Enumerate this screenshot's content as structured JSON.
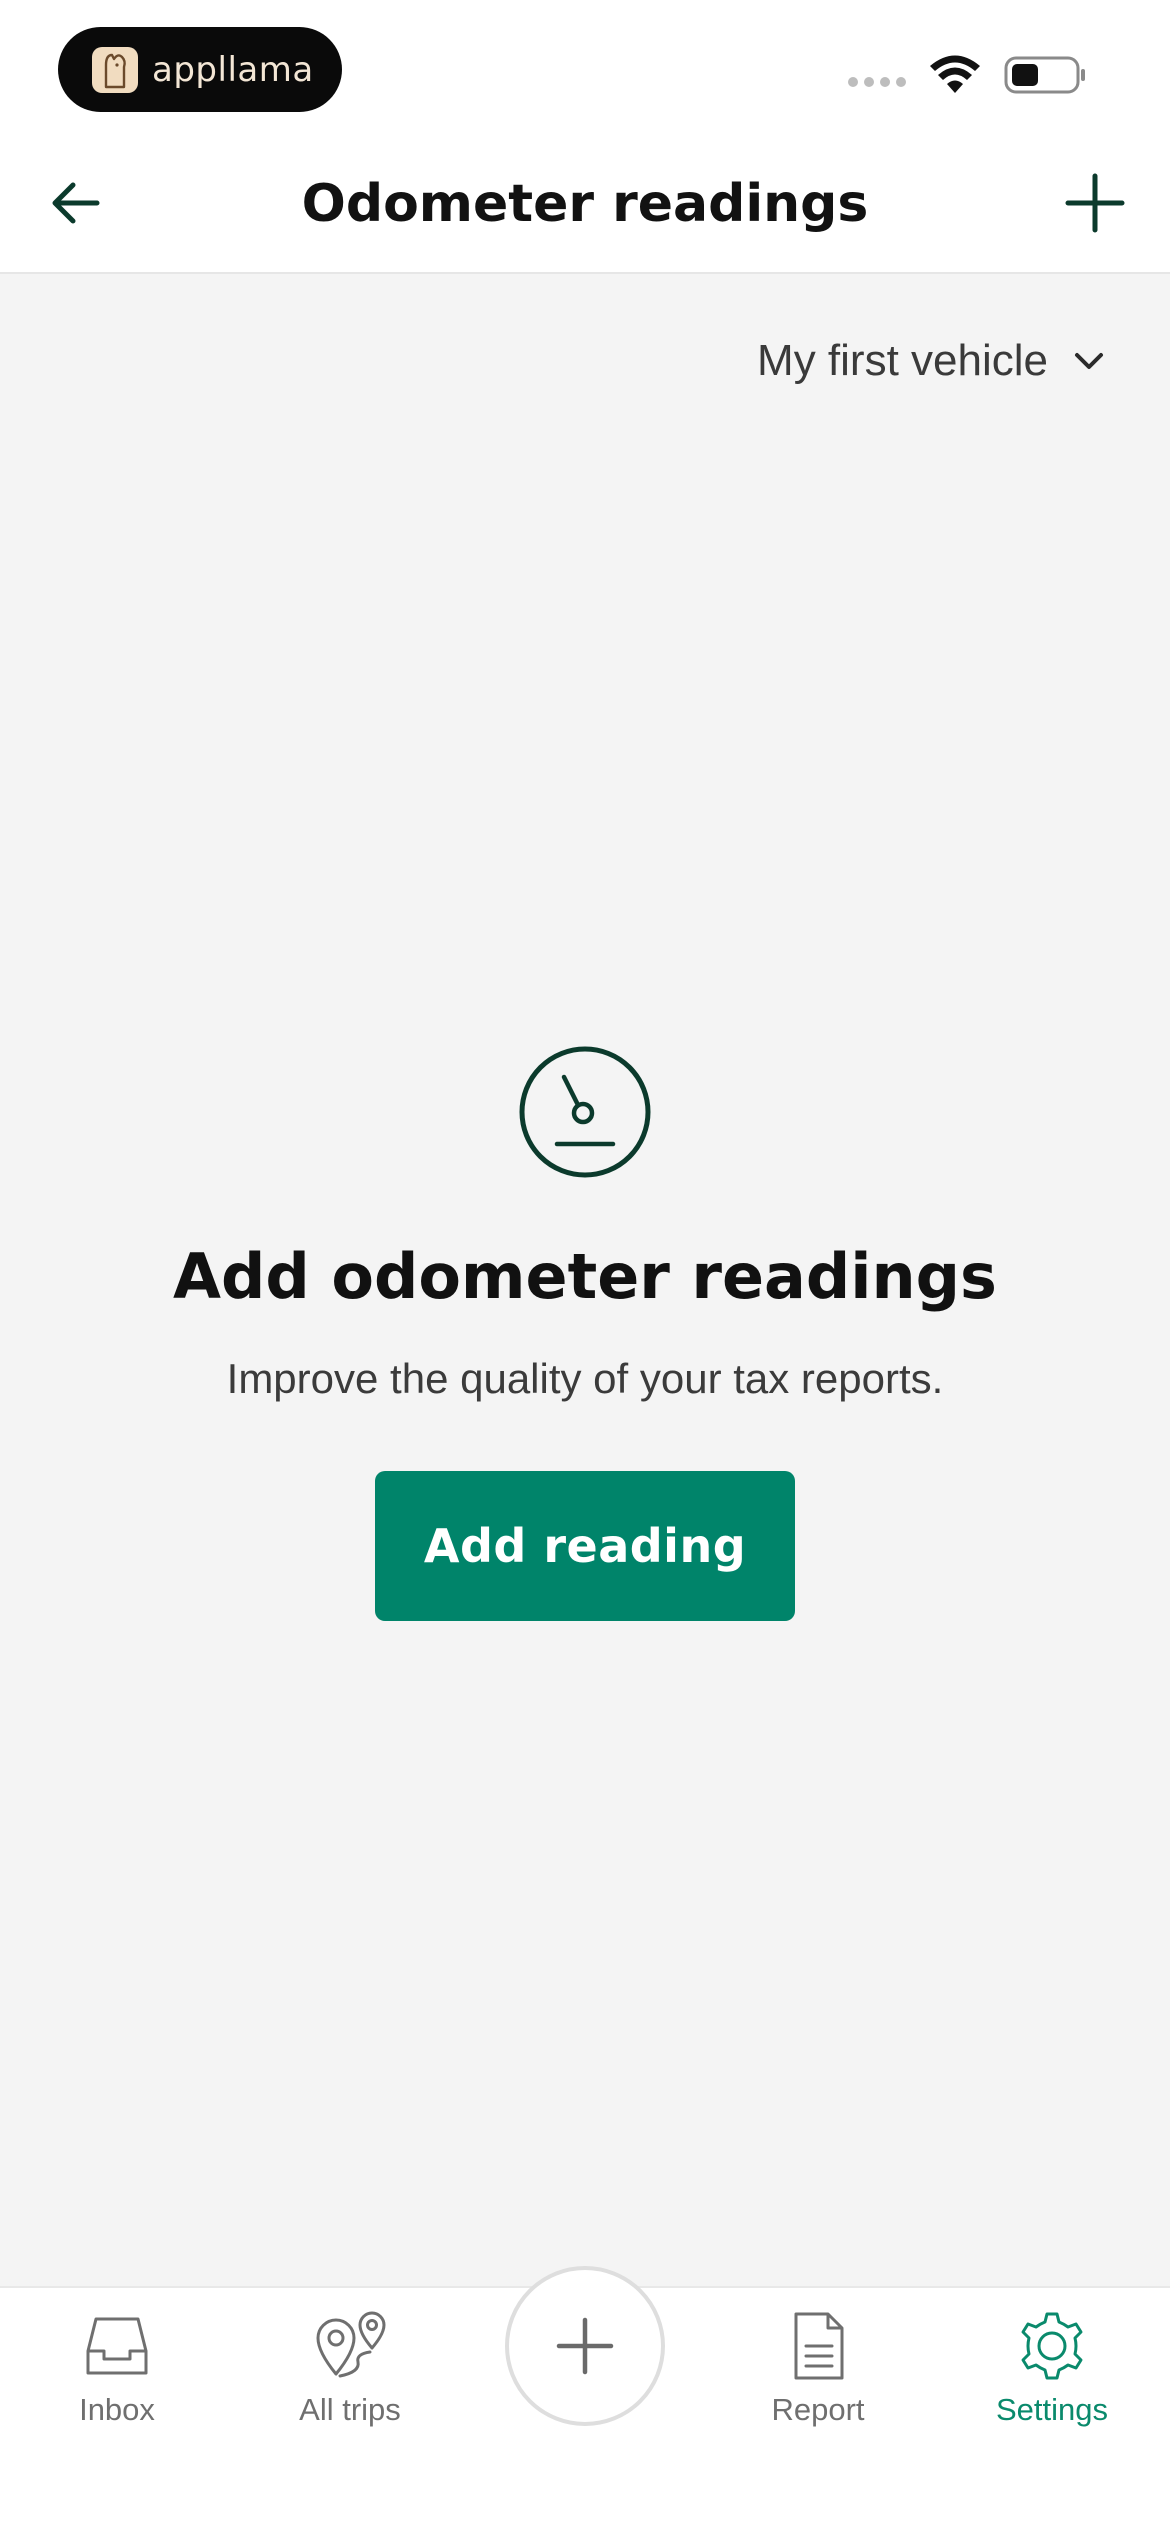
{
  "status_bar": {
    "brand_name": "appllama"
  },
  "header": {
    "title": "Odometer readings",
    "back_icon": "arrow-left-icon",
    "add_icon": "plus-icon"
  },
  "vehicle_selector": {
    "selected": "My first vehicle"
  },
  "empty_state": {
    "icon": "odometer-gauge-icon",
    "title": "Add odometer readings",
    "subtitle": "Improve the quality of your tax reports.",
    "button_label": "Add reading"
  },
  "bottom_nav": {
    "items": [
      {
        "label": "Inbox",
        "icon": "inbox-icon"
      },
      {
        "label": "All trips",
        "icon": "map-pin-route-icon"
      },
      {
        "label": "Report",
        "icon": "document-icon"
      },
      {
        "label": "Settings",
        "icon": "gear-icon"
      }
    ],
    "center_icon": "plus-icon",
    "active": "Settings"
  },
  "colors": {
    "accent": "#00846a",
    "header_icon": "#0b3a2c",
    "nav_active": "#0a8a6c",
    "background": "#f4f4f4"
  }
}
